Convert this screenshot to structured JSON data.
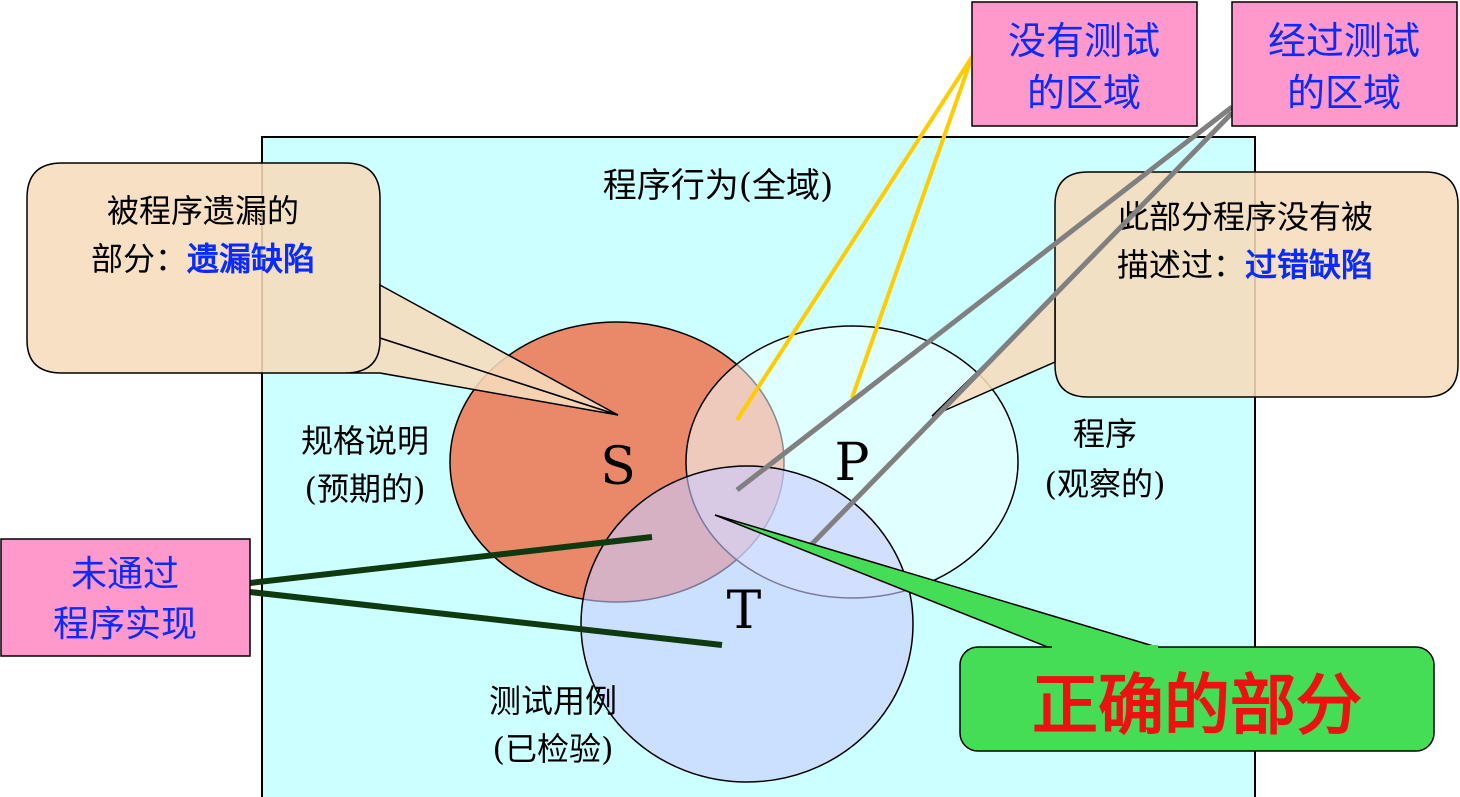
{
  "universe": {
    "label": "程序行为(全域)"
  },
  "sets": {
    "spec": {
      "letter": "S",
      "label_line1": "规格说明",
      "label_line2": "(预期的)"
    },
    "program": {
      "letter": "P",
      "label_line1": "程序",
      "label_line2": "(观察的)"
    },
    "tests": {
      "letter": "T",
      "label_line1": "测试用例",
      "label_line2": "(已检验)"
    }
  },
  "callouts": {
    "omission": {
      "line1": "被程序遗漏的",
      "line2_prefix": "部分：",
      "line2_emphasis": "遗漏缺陷"
    },
    "commission": {
      "line1": "此部分程序没有被",
      "line2_prefix": "描述过：",
      "line2_emphasis": "过错缺陷"
    },
    "untested": {
      "line1": "没有测试",
      "line2": "的区域"
    },
    "tested": {
      "line1": "经过测试",
      "line2": "的区域"
    },
    "not_implemented": {
      "line1": "未通过",
      "line2": "程序实现"
    },
    "correct": {
      "text": "正确的部分"
    }
  },
  "colors": {
    "universe_fill": "#ccffff",
    "spec_fill": "#e9896a",
    "program_fill": "#f0ffff",
    "tests_fill": "#c9c9ff",
    "callout_beige": "#f6dcbc",
    "callout_pink": "#ff99cc",
    "callout_green": "#44dd55",
    "emphasis_blue": "#0a2bff",
    "correct_text_red": "#ee1111",
    "line_yellow": "#ffcc00",
    "line_gray": "#808080",
    "line_darkgreen": "#0f3a0f"
  }
}
